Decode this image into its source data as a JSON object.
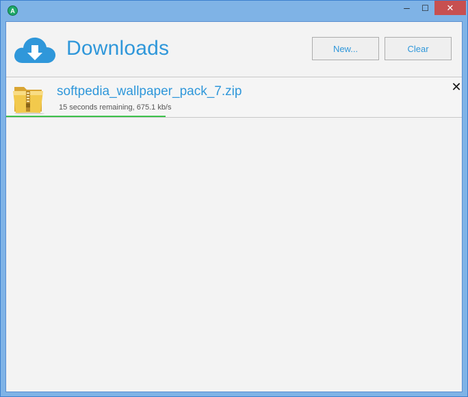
{
  "window": {
    "app_icon_letter": "A",
    "minimize_glyph": "─",
    "maximize_glyph": "☐",
    "close_glyph": "✕",
    "close_color": "#c75050"
  },
  "header": {
    "title": "Downloads",
    "new_button_label": "New...",
    "clear_button_label": "Clear",
    "logo_icon": "cloud-download-icon",
    "accent_color": "#2f97da"
  },
  "downloads": [
    {
      "file_name": "softpedia_wallpaper_pack_7.zip",
      "status": "15 seconds remaining, 675.1 kb/s",
      "icon": "zip-folder-icon",
      "progress_fraction": 0.35,
      "progress_color": "#3dc24a",
      "cancel_glyph": "✕"
    }
  ]
}
